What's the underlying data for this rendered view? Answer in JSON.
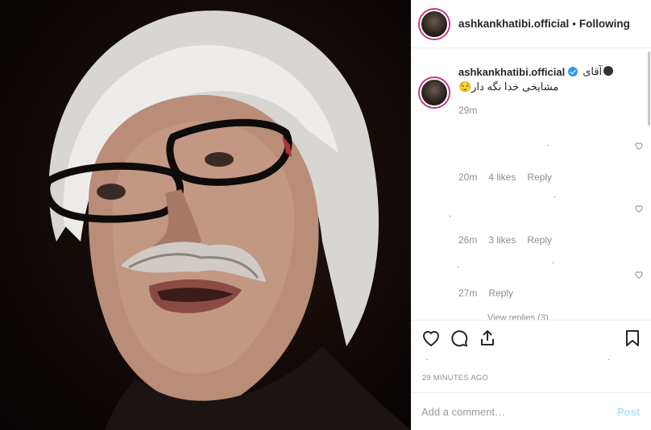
{
  "post": {
    "username": "ashkankhatibi.official",
    "follow_status": "Following",
    "dot": "•"
  },
  "caption": {
    "username": "ashkankhatibi.official",
    "line1": "آقای",
    "line2": "مشایخی خدا نگه دار😌",
    "time": "29m"
  },
  "comments": [
    {
      "time": "20m",
      "likes": "4 likes",
      "reply": "Reply"
    },
    {
      "time": "26m",
      "likes": "3 likes",
      "reply": "Reply"
    },
    {
      "time": "27m",
      "reply": "Reply"
    }
  ],
  "view_replies": "View replies (3)",
  "posted_time": "29 MINUTES AGO",
  "add_comment": {
    "placeholder": "Add a comment…",
    "post_label": "Post"
  },
  "colors": {
    "verified": "#3897f0",
    "post_disabled": "#b2dffc",
    "muted": "#8e8e8e"
  },
  "icons": [
    "heart-icon",
    "comment-icon",
    "share-icon",
    "bookmark-icon",
    "small-heart-icon",
    "verified-badge-icon"
  ]
}
